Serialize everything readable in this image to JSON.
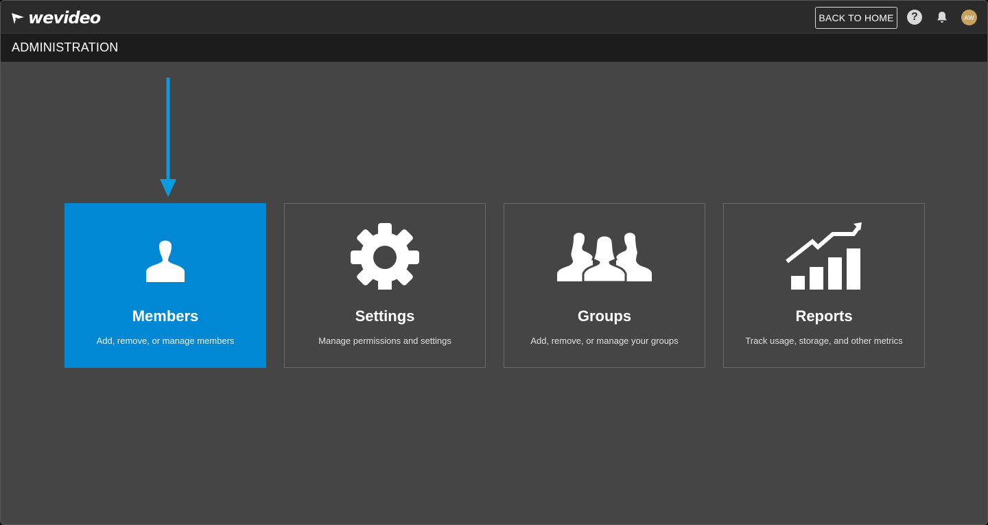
{
  "app": {
    "logo_text": "wevideo"
  },
  "topbar": {
    "back_home_label": "BACK TO HOME",
    "help_glyph": "?",
    "avatar_initials": "AW",
    "icons": [
      "logo-icon",
      "help-icon",
      "bell-icon",
      "avatar"
    ]
  },
  "subbar": {
    "title": "ADMINISTRATION"
  },
  "colors": {
    "accent": "#0088d4",
    "arrow": "#0a9be0",
    "background": "#454545",
    "topbar": "#2b2b2b",
    "subbar": "#1c1c1c"
  },
  "cards": [
    {
      "title": "Members",
      "description": "Add, remove, or manage members",
      "icon": "member-icon",
      "active": true
    },
    {
      "title": "Settings",
      "description": "Manage permissions and settings",
      "icon": "gear-icon",
      "active": false
    },
    {
      "title": "Groups",
      "description": "Add, remove, or manage your groups",
      "icon": "groups-icon",
      "active": false
    },
    {
      "title": "Reports",
      "description": "Track usage, storage, and other metrics",
      "icon": "reports-chart-icon",
      "active": false
    }
  ]
}
